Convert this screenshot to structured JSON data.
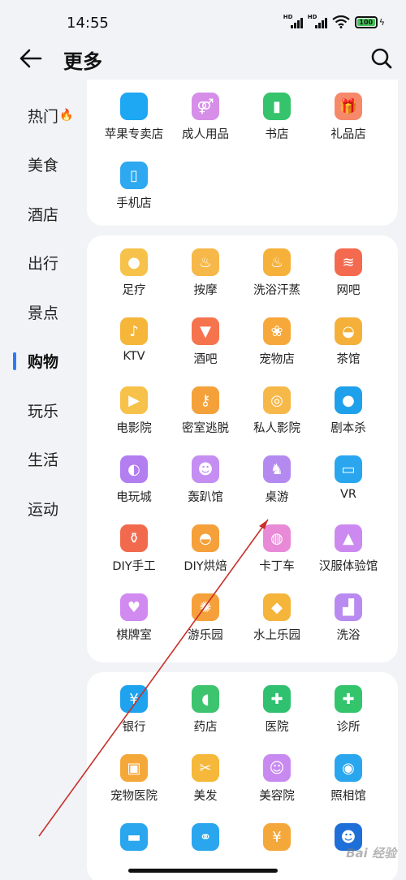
{
  "status": {
    "time": "14:55",
    "hd1": "HD",
    "hd2": "HD",
    "battery": "100"
  },
  "header": {
    "title": "更多",
    "back_icon": "back-arrow-icon",
    "search_icon": "search-icon"
  },
  "sidebar": {
    "items": [
      {
        "label": "热门",
        "fire": "🔥"
      },
      {
        "label": "美食"
      },
      {
        "label": "酒店"
      },
      {
        "label": "出行"
      },
      {
        "label": "景点"
      },
      {
        "label": "购物"
      },
      {
        "label": "玩乐"
      },
      {
        "label": "生活"
      },
      {
        "label": "运动"
      }
    ],
    "active_index": 5,
    "accent": "#2a7cf6"
  },
  "sections": [
    {
      "items": [
        {
          "label": "苹果专卖店",
          "icon": "apple-icon",
          "glyph": "",
          "color": "#1ea7f2"
        },
        {
          "label": "成人用品",
          "icon": "gender-icon",
          "glyph": "⚤",
          "color": "#d68ee8"
        },
        {
          "label": "书店",
          "icon": "book-icon",
          "glyph": "▮",
          "color": "#35c36b"
        },
        {
          "label": "礼品店",
          "icon": "gift-icon",
          "glyph": "🎁",
          "color": "#f5896a"
        },
        {
          "label": "手机店",
          "icon": "phone-icon",
          "glyph": "▯",
          "color": "#2ea8f0"
        }
      ]
    },
    {
      "items": [
        {
          "label": "足疗",
          "icon": "foot-icon",
          "glyph": "●",
          "color": "#f7c24a"
        },
        {
          "label": "按摩",
          "icon": "massage-icon",
          "glyph": "♨",
          "color": "#f7b84a"
        },
        {
          "label": "洗浴汗蒸",
          "icon": "steam-icon",
          "glyph": "♨",
          "color": "#f6b13a"
        },
        {
          "label": "网吧",
          "icon": "wifi-screen-icon",
          "glyph": "≋",
          "color": "#f46a50"
        },
        {
          "label": "KTV",
          "icon": "microphone-icon",
          "glyph": "♪",
          "color": "#f5b63a"
        },
        {
          "label": "酒吧",
          "icon": "cocktail-icon",
          "glyph": "▼",
          "color": "#f5744e"
        },
        {
          "label": "宠物店",
          "icon": "paw-icon",
          "glyph": "❀",
          "color": "#f7a83a"
        },
        {
          "label": "茶馆",
          "icon": "tea-bowl-icon",
          "glyph": "◒",
          "color": "#f5b03a"
        },
        {
          "label": "电影院",
          "icon": "film-icon",
          "glyph": "▶",
          "color": "#f7c24a"
        },
        {
          "label": "密室逃脱",
          "icon": "key-icon",
          "glyph": "⚷",
          "color": "#f5a13a"
        },
        {
          "label": "私人影院",
          "icon": "film-reel-icon",
          "glyph": "◎",
          "color": "#f7b84a"
        },
        {
          "label": "剧本杀",
          "icon": "detective-icon",
          "glyph": "●",
          "color": "#1fa0ea"
        },
        {
          "label": "电玩城",
          "icon": "pacman-icon",
          "glyph": "◐",
          "color": "#b27ef0"
        },
        {
          "label": "轰趴馆",
          "icon": "mask-icon",
          "glyph": "☻",
          "color": "#c58ef2"
        },
        {
          "label": "桌游",
          "icon": "chess-knight-icon",
          "glyph": "♞",
          "color": "#b58af0"
        },
        {
          "label": "VR",
          "icon": "vr-headset-icon",
          "glyph": "▭",
          "color": "#2aa6ee"
        },
        {
          "label": "DIY手工",
          "icon": "vase-icon",
          "glyph": "⚱",
          "color": "#f26a4e"
        },
        {
          "label": "DIY烘焙",
          "icon": "chef-hat-icon",
          "glyph": "◓",
          "color": "#f5a03a"
        },
        {
          "label": "卡丁车",
          "icon": "kart-icon",
          "glyph": "◍",
          "color": "#e88ad8"
        },
        {
          "label": "汉服体验馆",
          "icon": "hanfu-icon",
          "glyph": "▲",
          "color": "#cc8af0"
        },
        {
          "label": "棋牌室",
          "icon": "cards-icon",
          "glyph": "♥",
          "color": "#d08af0"
        },
        {
          "label": "游乐园",
          "icon": "ferris-wheel-icon",
          "glyph": "✺",
          "color": "#f5a03a"
        },
        {
          "label": "水上乐园",
          "icon": "rubber-duck-icon",
          "glyph": "◆",
          "color": "#f5b43a"
        },
        {
          "label": "洗浴",
          "icon": "bath-icon",
          "glyph": "▟",
          "color": "#b98af0"
        }
      ]
    },
    {
      "items": [
        {
          "label": "银行",
          "icon": "bank-icon",
          "glyph": "¥",
          "color": "#1fa3ee"
        },
        {
          "label": "药店",
          "icon": "pill-icon",
          "glyph": "◖",
          "color": "#3ec46e"
        },
        {
          "label": "医院",
          "icon": "hospital-icon",
          "glyph": "✚",
          "color": "#2fc070"
        },
        {
          "label": "诊所",
          "icon": "medkit-icon",
          "glyph": "✚",
          "color": "#33c46c"
        },
        {
          "label": "宠物医院",
          "icon": "pet-hospital-icon",
          "glyph": "▣",
          "color": "#f5a83a"
        },
        {
          "label": "美发",
          "icon": "scissors-icon",
          "glyph": "✂",
          "color": "#f5b83a"
        },
        {
          "label": "美容院",
          "icon": "face-mask-icon",
          "glyph": "☺",
          "color": "#c88af0"
        },
        {
          "label": "照相馆",
          "icon": "camera-icon",
          "glyph": "◉",
          "color": "#2aa6ee"
        },
        {
          "label": "",
          "icon": "card-icon",
          "glyph": "▬",
          "color": "#2aa6ee"
        },
        {
          "label": "",
          "icon": "restroom-icon",
          "glyph": "⚭",
          "color": "#2aa6ee"
        },
        {
          "label": "",
          "icon": "yuan-icon",
          "glyph": "¥",
          "color": "#f5a83a"
        },
        {
          "label": "",
          "icon": "service-icon",
          "glyph": "☻",
          "color": "#1f6fd8"
        }
      ]
    }
  ],
  "watermark": "Bai 经验"
}
